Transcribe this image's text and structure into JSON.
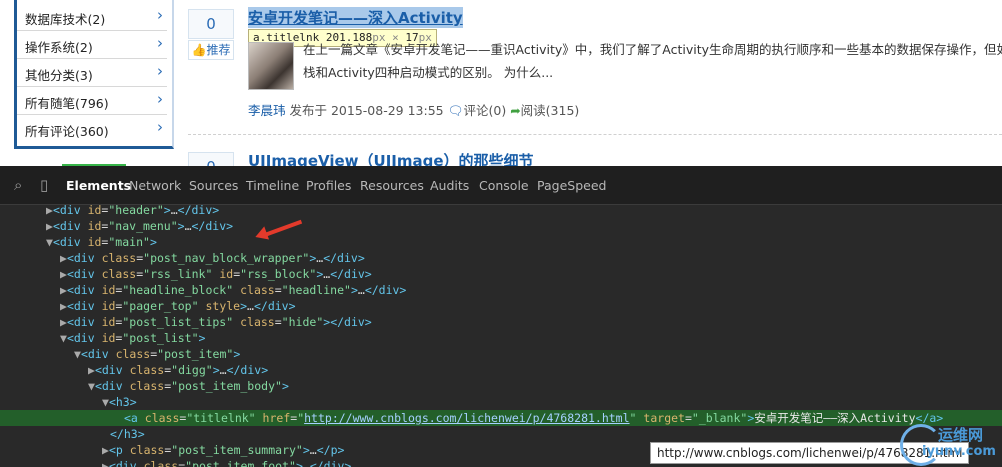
{
  "sidebar": {
    "categories": [
      {
        "label": "数据库技术(2)"
      },
      {
        "label": "操作系统(2)"
      },
      {
        "label": "其他分类(3)"
      },
      {
        "label": "所有随笔(796)"
      },
      {
        "label": "所有评论(360)"
      }
    ],
    "arrow_glyph": "›"
  },
  "post1": {
    "digg": "0",
    "recommend": "推荐",
    "title": "安卓开发笔记——深入Activity",
    "summary": "在上一篇文章《安卓开发笔记——重识Activity》中，我们了解了Activity生命周期的执行顺序和一些基本的数据保存操作，但如果只",
    "summary2": "栈和Activity四种启动模式的区别。 为什么...",
    "author": "李晨玮",
    "published": "发布于 2015-08-29 13:55",
    "comments": "评论(0)",
    "reads": "阅读(315)"
  },
  "tooltip": {
    "selector": "a.titlelnk",
    "width": "201.188",
    "unit1": "px",
    "times": "×",
    "height": "17",
    "unit2": "px"
  },
  "post2": {
    "digg": "0",
    "title": "UIImageView（UIImage）的那些细节"
  },
  "devtools": {
    "tabs": [
      "Elements",
      "Network",
      "Sources",
      "Timeline",
      "Profiles",
      "Resources",
      "Audits",
      "Console",
      "PageSpeed"
    ],
    "active_tab": "Elements",
    "lines": {
      "l1": {
        "id": "header"
      },
      "l2": {
        "id": "nav_menu"
      },
      "l3": {
        "id": "main"
      },
      "l4": {
        "cls": "post_nav_block_wrapper"
      },
      "l5": {
        "cls": "rss_link",
        "id": "rss_block"
      },
      "l6": {
        "id": "headline_block",
        "cls": "headline"
      },
      "l7": {
        "id": "pager_top"
      },
      "l8": {
        "id": "post_list_tips",
        "cls": "hide"
      },
      "l9": {
        "id": "post_list"
      },
      "l10": {
        "cls": "post_item"
      },
      "l11": {
        "cls": "digg"
      },
      "l12": {
        "cls": "post_item_body"
      },
      "l14": {
        "cls": "titlelnk",
        "href": "http://www.cnblogs.com/lichenwei/p/4768281.html",
        "target": "_blank",
        "text": "安卓开发笔记——深入Activity"
      },
      "l16": {
        "cls": "post_item_summary"
      },
      "l17": {
        "cls": "post_item_foot"
      }
    }
  },
  "url_tooltip": "http://www.cnblogs.com/lichenwei/p/4768281.html",
  "watermark": {
    "t1": "运维网",
    "t2": "iyunv.com"
  }
}
